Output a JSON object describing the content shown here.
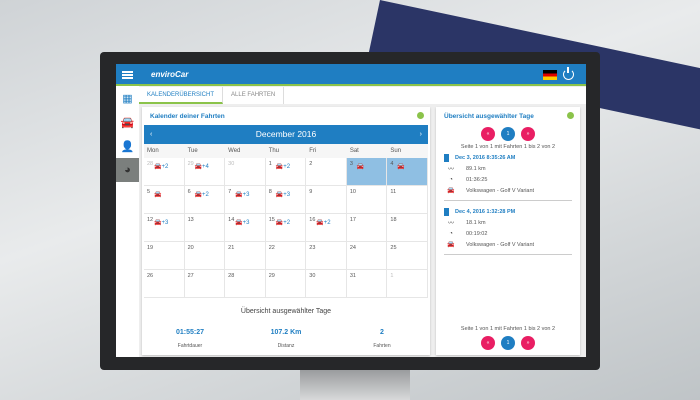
{
  "header": {
    "logo": "enviroCar",
    "language": "Deutsch"
  },
  "sidebar": {
    "items": [
      {
        "name": "dashboard",
        "icon": "▦"
      },
      {
        "name": "tracks",
        "icon": "🚘"
      },
      {
        "name": "profile",
        "icon": "👤"
      },
      {
        "name": "statistics",
        "icon": "◕"
      }
    ]
  },
  "tabs": [
    {
      "label": "KALENDERÜBERSICHT",
      "active": true
    },
    {
      "label": "ALLE FAHRTEN",
      "active": false
    }
  ],
  "calendar": {
    "title": "Kalender deiner Fahrten",
    "month": "December 2016",
    "prev": "‹",
    "next": "›",
    "day_names": [
      "Mon",
      "Tue",
      "Wed",
      "Thu",
      "Fri",
      "Sat",
      "Sun"
    ],
    "days": [
      {
        "d": "28",
        "muted": true,
        "trips": "+2"
      },
      {
        "d": "29",
        "muted": true,
        "trips": "+4"
      },
      {
        "d": "30",
        "muted": true
      },
      {
        "d": "1",
        "trips": "+2"
      },
      {
        "d": "2"
      },
      {
        "d": "3",
        "sel": true,
        "trips": ""
      },
      {
        "d": "4",
        "sel": true,
        "trips": ""
      },
      {
        "d": "5",
        "trips": ""
      },
      {
        "d": "6",
        "trips": "+2"
      },
      {
        "d": "7",
        "trips": "+3"
      },
      {
        "d": "8",
        "trips": "+3"
      },
      {
        "d": "9"
      },
      {
        "d": "10"
      },
      {
        "d": "11"
      },
      {
        "d": "12",
        "trips": "+3"
      },
      {
        "d": "13"
      },
      {
        "d": "14",
        "trips": "+3"
      },
      {
        "d": "15",
        "trips": "+2"
      },
      {
        "d": "16",
        "trips": "+2"
      },
      {
        "d": "17"
      },
      {
        "d": "18"
      },
      {
        "d": "19"
      },
      {
        "d": "20"
      },
      {
        "d": "21"
      },
      {
        "d": "22"
      },
      {
        "d": "23"
      },
      {
        "d": "24"
      },
      {
        "d": "25"
      },
      {
        "d": "26"
      },
      {
        "d": "27"
      },
      {
        "d": "28"
      },
      {
        "d": "29"
      },
      {
        "d": "30"
      },
      {
        "d": "31"
      },
      {
        "d": "1",
        "muted": true
      }
    ]
  },
  "summary": {
    "title": "Übersicht ausgewählter Tage",
    "stats": [
      {
        "value": "01:55:27",
        "label": "Fahrtdauer"
      },
      {
        "value": "107.2 Km",
        "label": "Distanz"
      },
      {
        "value": "2",
        "label": "Fahrten"
      }
    ]
  },
  "selected": {
    "title": "Übersicht ausgewählter Tage",
    "pager": {
      "first": "«",
      "page": "1",
      "last": "»",
      "text": "Seite 1 von 1 mit Fahrten 1 bis 2 von 2"
    },
    "trips": [
      {
        "date": "Dec 3, 2016 8:35:26 AM",
        "distance": "89.1 km",
        "duration": "01:36:25",
        "car": "Volkswagen - Golf V Variant"
      },
      {
        "date": "Dec 4, 2016 1:32:28 PM",
        "distance": "18.1 km",
        "duration": "00:19:02",
        "car": "Volkswagen - Golf V Variant"
      }
    ]
  },
  "colors": {
    "primary": "#1f7ec2",
    "accent": "#8bc34a",
    "pager": "#e91e63"
  }
}
